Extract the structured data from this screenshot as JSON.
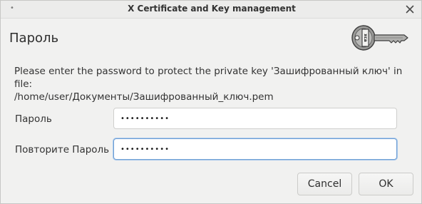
{
  "window": {
    "title": "X Certificate and Key management",
    "menu_dot": "•"
  },
  "dialog": {
    "heading": "Пароль",
    "message_line1": "Please enter the password to protect the private key 'Зашифрованный ключ' in file:",
    "message_line2": "/home/user/Документы/Зашифрованный_ключ.pem",
    "key_badge_text": "xca"
  },
  "fields": {
    "password_label": "Пароль",
    "password_value": "••••••••••",
    "repeat_label": "Повторите Пароль",
    "repeat_value": "••••••••••"
  },
  "buttons": {
    "cancel_label": "Cancel",
    "ok_label": "OK"
  },
  "colors": {
    "focus_border": "#6f9fd4",
    "background": "#f1f1f0"
  },
  "icons": [
    "close-icon",
    "key-icon"
  ]
}
